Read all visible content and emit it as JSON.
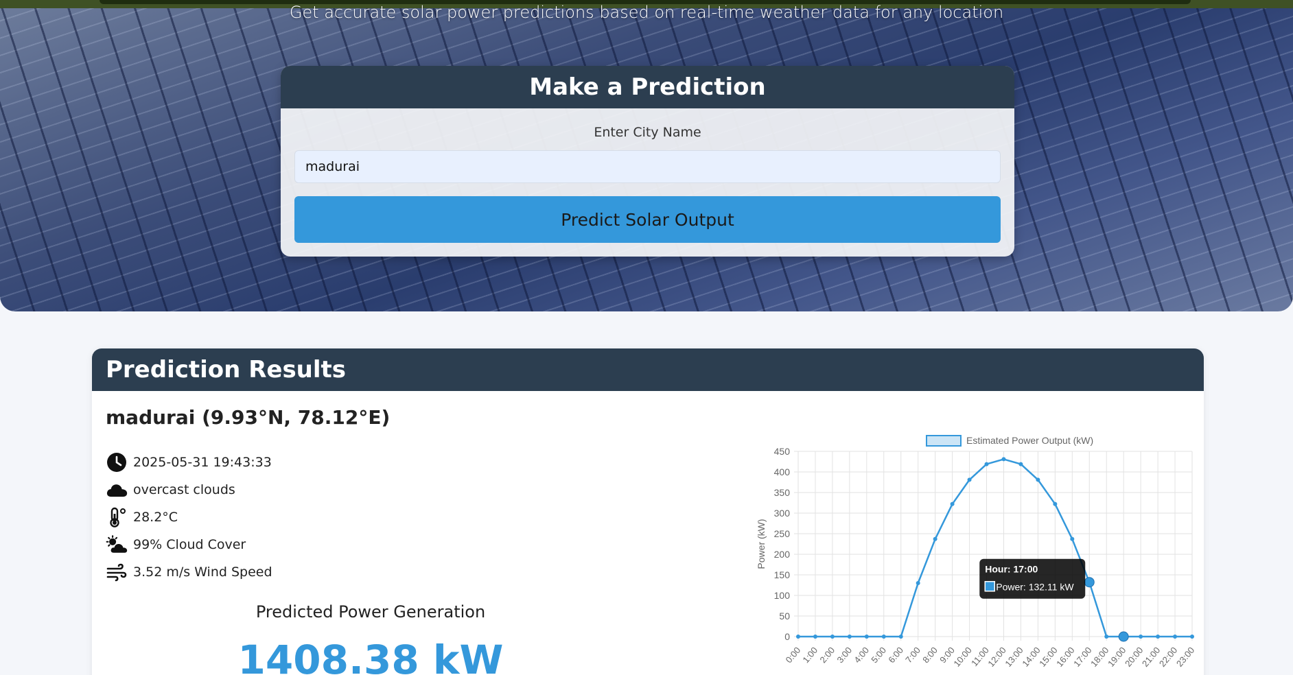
{
  "hero": {
    "subtitle": "Get accurate solar power predictions based on real-time weather data for any location"
  },
  "predict": {
    "title": "Make a Prediction",
    "city_label": "Enter City Name",
    "city_value": "madurai",
    "button_label": "Predict Solar Output"
  },
  "results": {
    "title": "Prediction Results",
    "location": "madurai (9.93°N, 78.12°E)",
    "timestamp": "2025-05-31 19:43:33",
    "weather": "overcast clouds",
    "temperature": "28.2°C",
    "cloud_cover": "99% Cloud Cover",
    "wind_speed": "3.52 m/s Wind Speed",
    "generation_title": "Predicted Power Generation",
    "generation_value": "1408.38 kW"
  },
  "icons": [
    "clock-icon",
    "cloud-icon",
    "thermometer-icon",
    "cloud-sun-icon",
    "wind-icon"
  ],
  "colors": {
    "accent": "#3498db",
    "header": "#2c3e50"
  },
  "chart_data": {
    "type": "line",
    "legend": "Estimated Power Output (kW)",
    "legend_position": "top",
    "ylabel": "Power (kW)",
    "xlabel": "",
    "ylim": [
      0,
      450
    ],
    "yticks": [
      0,
      50,
      100,
      150,
      200,
      250,
      300,
      350,
      400,
      450
    ],
    "grid": true,
    "categories": [
      "0:00",
      "1:00",
      "2:00",
      "3:00",
      "4:00",
      "5:00",
      "6:00",
      "7:00",
      "8:00",
      "9:00",
      "10:00",
      "11:00",
      "12:00",
      "13:00",
      "14:00",
      "15:00",
      "16:00",
      "17:00",
      "18:00",
      "19:00",
      "20:00",
      "21:00",
      "22:00",
      "23:00"
    ],
    "series": [
      {
        "name": "Estimated Power Output (kW)",
        "values": [
          0,
          0,
          0,
          0,
          0,
          0,
          0,
          130,
          237,
          322,
          381,
          419,
          431,
          419,
          381,
          322,
          237,
          132.11,
          0,
          0,
          0,
          0,
          0,
          0
        ]
      }
    ],
    "tooltip": {
      "title": "Hour: 17:00",
      "label": "Power: 132.11 kW",
      "index": 17
    },
    "highlighted_index": 19
  }
}
